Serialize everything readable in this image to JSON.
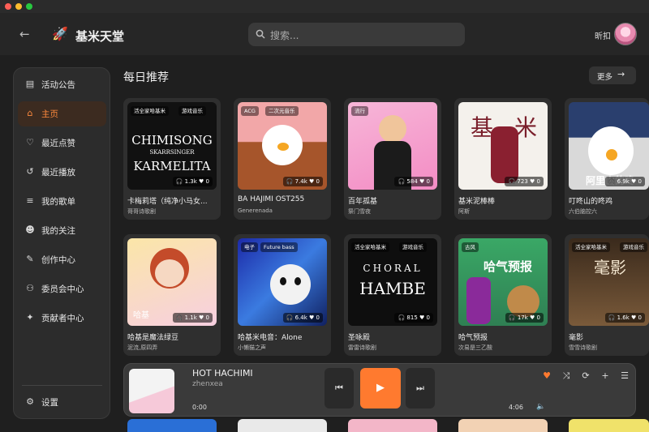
{
  "window": {
    "controls": [
      "close",
      "minimize",
      "maximize"
    ]
  },
  "header": {
    "back_icon": "arrow-left-icon",
    "logo_icon": "rocket-logo-icon",
    "title": "基米天堂",
    "search": {
      "placeholder": "搜索..."
    },
    "username": "昕扣"
  },
  "sidebar": {
    "items": [
      {
        "label": "活动公告",
        "icon": "announcement-icon",
        "active": false
      },
      {
        "label": "主页",
        "icon": "home-icon",
        "active": true
      },
      {
        "label": "最近点赞",
        "icon": "heart-icon",
        "active": false
      },
      {
        "label": "最近播放",
        "icon": "history-icon",
        "active": false
      },
      {
        "label": "我的歌单",
        "icon": "playlist-icon",
        "active": false
      },
      {
        "label": "我的关注",
        "icon": "follow-icon",
        "active": false
      },
      {
        "label": "创作中心",
        "icon": "pen-icon",
        "active": false
      },
      {
        "label": "委员会中心",
        "icon": "group-icon",
        "active": false
      },
      {
        "label": "贡献者中心",
        "icon": "wrench-icon",
        "active": false
      }
    ],
    "settings": {
      "label": "设置",
      "icon": "gear-icon"
    }
  },
  "main": {
    "section_title": "每日推荐",
    "more_label": "更多",
    "cards": [
      {
        "title": "卡梅莉塔（纯净小马女...",
        "subtitle": "哥哥诗歌剧",
        "tags": [
          "活全家哈基米",
          "游戏音乐"
        ],
        "plays": "1.3k",
        "likes": "0",
        "cover_text": [
          "CHIMISONG",
          "SKARRSINGER",
          "KARMELITA"
        ]
      },
      {
        "title": "BA HAJIMI OST255",
        "subtitle": "Generenada",
        "tags": [
          "ACG",
          "二次元音乐"
        ],
        "plays": "7.4k",
        "likes": "0",
        "cover_text": []
      },
      {
        "title": "百年孤基",
        "subtitle": "祭门雪夜",
        "tags": [
          "流行"
        ],
        "plays": "584",
        "likes": "0",
        "cover_text": []
      },
      {
        "title": "基米泥棒棒",
        "subtitle": "阿斯",
        "tags": [],
        "plays": "723",
        "likes": "0",
        "cover_text": [
          "基",
          "米"
        ]
      },
      {
        "title": "叮咚山的咚鸡",
        "subtitle": "六伯脑控六",
        "tags": [],
        "plays": "6.9k",
        "likes": "0",
        "cover_text": [
          "阿里山的咚"
        ]
      },
      {
        "title": "哈基是魔法绿豆",
        "subtitle": "泥流,原四弄",
        "tags": [],
        "plays": "1.1k",
        "likes": "0",
        "cover_text": [
          "哈基"
        ]
      },
      {
        "title": "哈基米电音：Alone",
        "subtitle": "小懒猫之声",
        "tags": [
          "电子",
          "Future bass"
        ],
        "plays": "6.4k",
        "likes": "0",
        "cover_text": []
      },
      {
        "title": "圣咏殿",
        "subtitle": "雷雷诗歌剧",
        "tags": [
          "活全家哈基米",
          "游戏音乐"
        ],
        "plays": "815",
        "likes": "0",
        "cover_text": [
          "CHORAL",
          "HAMBE"
        ]
      },
      {
        "title": "哈气预报",
        "subtitle": "次易是三乙酸",
        "tags": [
          "古风"
        ],
        "plays": "17k",
        "likes": "0",
        "cover_text": [
          "哈气预报"
        ]
      },
      {
        "title": "毫影",
        "subtitle": "雪雪诗歌剧",
        "tags": [
          "活全家哈基米",
          "游戏音乐"
        ],
        "plays": "1.6k",
        "likes": "0",
        "cover_text": [
          "毫影"
        ]
      }
    ]
  },
  "player": {
    "title": "HOT HACHIMI",
    "artist": "zhenxea",
    "time_current": "0:00",
    "time_total": "4:06",
    "progress": 0.0,
    "liked": true,
    "accent": "#ff7a2f",
    "controls": [
      "heart-icon",
      "shuffle-icon",
      "repeat-icon",
      "add-icon",
      "queue-icon"
    ],
    "volume_icon": "volume-icon"
  },
  "colors": {
    "accent": "#ff7a2f",
    "background": "#1f1f1f",
    "panel": "#2c2c2c"
  }
}
